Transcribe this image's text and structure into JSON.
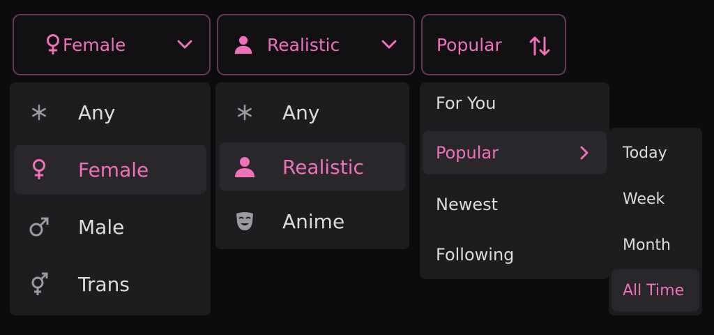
{
  "filters": {
    "gender": {
      "label": "Female",
      "icon": "female-icon",
      "caret": "chevron-down-icon"
    },
    "style": {
      "label": "Realistic",
      "icon": "person-icon",
      "caret": "chevron-down-icon"
    },
    "sort": {
      "label": "Popular",
      "icon": "sort-arrows-icon"
    }
  },
  "gender_menu": {
    "items": [
      {
        "label": "Any",
        "icon": "asterisk-icon",
        "selected": false
      },
      {
        "label": "Female",
        "icon": "female-icon",
        "selected": true
      },
      {
        "label": "Male",
        "icon": "male-icon",
        "selected": false
      },
      {
        "label": "Trans",
        "icon": "transgender-icon",
        "selected": false
      }
    ]
  },
  "style_menu": {
    "items": [
      {
        "label": "Any",
        "icon": "asterisk-icon",
        "selected": false
      },
      {
        "label": "Realistic",
        "icon": "person-icon",
        "selected": true
      },
      {
        "label": "Anime",
        "icon": "mask-icon",
        "selected": false
      }
    ]
  },
  "sort_menu": {
    "items": [
      {
        "label": "For You",
        "selected": false
      },
      {
        "label": "Popular",
        "selected": true,
        "submenu_icon": "chevron-right-icon"
      },
      {
        "label": "Newest",
        "selected": false
      },
      {
        "label": "Following",
        "selected": false
      }
    ]
  },
  "time_menu": {
    "items": [
      {
        "label": "Today",
        "selected": false
      },
      {
        "label": "Week",
        "selected": false
      },
      {
        "label": "Month",
        "selected": false
      },
      {
        "label": "All Time",
        "selected": true
      }
    ]
  },
  "colors": {
    "accent": "#ee72b9",
    "text": "#dcdbdd",
    "icon_muted": "#9c9a9f",
    "menu_bg": "#1d1c1f",
    "item_active_bg": "#29272b",
    "trigger_border": "#6a3a55",
    "page_bg": "#0c0b0d"
  }
}
